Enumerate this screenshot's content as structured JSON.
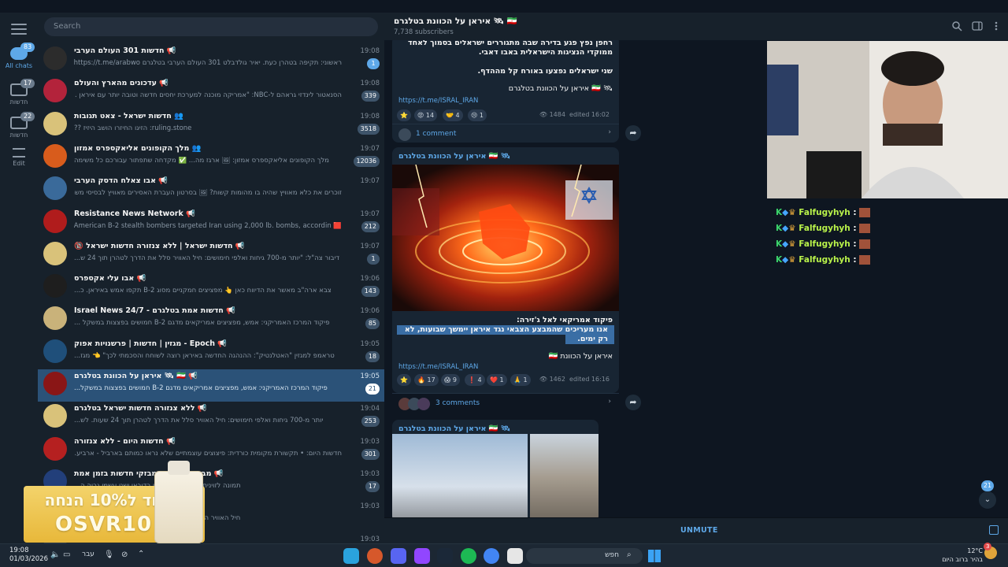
{
  "window": {
    "controls": [
      "–",
      "▢",
      "✕"
    ]
  },
  "rail": {
    "folders": [
      {
        "label": "All chats",
        "badge": "83"
      },
      {
        "label": "חדשות",
        "badge": "17"
      },
      {
        "label": "חדשות",
        "badge": "22"
      },
      {
        "label": "Edit",
        "badge": ""
      }
    ]
  },
  "search": {
    "placeholder": "Search"
  },
  "chats": [
    {
      "name": "📢 חדשות 301 העולם הערבי",
      "time": "19:08",
      "preview": "ראשוני: תקיפה בטהרן כעת. יאיר גולדבלט 301 העולם הערבי בטלגרם https://t.me/arabwo...",
      "count": "1",
      "blue": true
    },
    {
      "name": "📢 עדכונים מהארץ והעולם",
      "time": "19:08",
      "preview": "הסנאטור לינדזי גראהם ל-NBC: \"אמריקה מוכנה למערכת יחסים חדשה וטובה יותר עם איראן ...",
      "count": "339",
      "blue": false
    },
    {
      "name": "👥 חדשות ישראל - צאט תגובות",
      "time": "19:08",
      "preview": "ruling.stone: הזיגו החיזרו הושב היזיז ??",
      "count": "3518",
      "blue": false
    },
    {
      "name": "👥 מלך הקופונים אליאקספרס אמזון",
      "time": "19:07",
      "preview": "מלך הקופונים אליאקספרס אמזון: 🖼 ארגז מה... ✅ מקדחה שתפתור עבורכם כל משימה",
      "count": "12036",
      "blue": false
    },
    {
      "name": "📢 אבו צאלח הדסק הערבי",
      "time": "19:07",
      "preview": "זוכרים את כלא מאוויץ שהיה בו מהומות קשות? 🖼 בסרטון העברת האסירים מאוויץ לבסיסי משמרו...",
      "count": "",
      "blue": false
    },
    {
      "name": "📢 Resistance News Network",
      "time": "19:07",
      "preview": "🟥 Last night, American B-2 stealth bombers targeted Iran using 2,000 lb. bombs, accordin...",
      "count": "212",
      "blue": false
    },
    {
      "name": "📢 חדשות ישראל | ללא צנזורה חדשות ישראל 🔞",
      "time": "19:07",
      "preview": "דיבור צה\"ל: \"יותר מ-700 גיחות ואלפי חימושים: חיל האוויר סלל את הדרך לטהרן תוך 24 ש...",
      "count": "1",
      "blue": false
    },
    {
      "name": "📢 אבו עלי אקספרס",
      "time": "19:06",
      "preview": "צבא ארה\"ב מאשר את הדיווח כאן 👆 מפציצים חמקניים מסוג B-2 תקפו אמש באיראן. כ...",
      "count": "143",
      "blue": false
    },
    {
      "name": "📢 חדשות אמת בטלגרם - Israel News 24/7",
      "time": "19:06",
      "preview": "פיקוד המרכז האמריקני: אמש, מפציצים אמריקאים מדגם B-2 חמושים בפצצות במשקל ...",
      "count": "85",
      "blue": false
    },
    {
      "name": "📢 Epoch - מגזין | חדשות | פרשנויות אפוק",
      "time": "19:05",
      "preview": "טראמפ למגזין \"האטלנטיק\": ההנהגה החדשה באיראן רוצה לשוחח והסכמתי לכך\" 👈 מגז...",
      "count": "18",
      "blue": false
    },
    {
      "name": "📢 🇮🇷 🛰 איראן על הכוונת בטלגרם",
      "time": "19:05",
      "preview": "פיקוד המרכז האמריקני: אמש, מפציצים אמריקאים מדגם B-2 חמושים בפצצות במשקל...",
      "count": "21",
      "blue": false
    },
    {
      "name": "📢 ללא צנזורה חדשות ישראל בטלגרם",
      "time": "19:04",
      "preview": "יותר מ-700 גיחות ואלפי חימושים: חיל האוויר סלל את הדרך לטהרן תוך 24 שעות. לש...",
      "count": "253",
      "blue": false
    },
    {
      "name": "📢 חדשות היום - ללא צנזורה",
      "time": "19:03",
      "preview": "חדשות היום: • תקשורת מקומית כורדית: פיצוצים עוצמתיים שלא נראו כמותם בארביל - ארביע...",
      "count": "301",
      "blue": false
    },
    {
      "name": "📢 מבזקי חדשות - מבזקי חדשות בזמן אמת",
      "time": "19:03",
      "preview": "תמונה לזוינית של נמל ג'בל עלי בדובאי ישני עשמי גבוה ה...",
      "count": "17",
      "blue": false
    },
    {
      "name": "",
      "time": "19:03",
      "preview": "חיל האוויר השיג עליונות אווירית בבירת איראן תוך 24 שעות",
      "count": "",
      "blue": false
    },
    {
      "name": "",
      "time": "19:03",
      "preview": "",
      "count": "",
      "blue": false
    }
  ],
  "header": {
    "title": "🇮🇷 🛰 איראן על הכוונת בטלגרם",
    "subscribers": "7,738 subscribers"
  },
  "messages": [
    {
      "text1": "רחפן נפץ פגע בדירה שבה מתגוררים ישראלים בסמוך לאחד",
      "text2": "ממוקדי הנציגות הישראלית באבו דאבי.",
      "text3": "שני ישראלים נפצעו באורח קל מההדף.",
      "sig": "🛰 🇮🇷 איראן על הכוונת בטלגרם",
      "link": "https://t.me/ISRAL_IRAN",
      "reactions": [
        "⭐",
        "😡 14",
        "🤝 4",
        "😢 1"
      ],
      "views": "👁 1484",
      "edited": "edited 16:02",
      "comments": "1 comment"
    },
    {
      "sender": "🛰 🇮🇷 איראן על הכוונת בטלגרם",
      "text1": "פיקוד אמריקאי לאל ג'זירה:",
      "text2": "אנו מעריכים שהמבצע הצבאי נגד איראן יימשך שבועות, לא",
      "text3": "רק ימים.",
      "sig": "איראן על הכוונת 🇮🇷",
      "link": "https://t.me/ISRAL_IRAN",
      "reactions": [
        "⭐",
        "🔥 17",
        "😱 9",
        "❗ 4",
        "❤️ 1",
        "🙏 1"
      ],
      "views": "👁 1462",
      "edited": "edited 16:16",
      "comments": "3 comments"
    },
    {
      "sender": "🛰 🇮🇷 איראן על הכוונת בטלגרם"
    }
  ],
  "overlay": {
    "lines": [
      {
        "user": "Falfugyhyh",
        "sep": ":"
      },
      {
        "user": "Falfugyhyh",
        "sep": ":"
      },
      {
        "user": "Falfugyhyh",
        "sep": ":"
      },
      {
        "user": "Falfugyhyh",
        "sep": ":"
      }
    ]
  },
  "promo": {
    "line1": "קוד ל10% הנחה",
    "line2": "OSVR10"
  },
  "scroll_badge": "21",
  "input": {
    "unmute": "UNMUTE"
  },
  "taskbar": {
    "time": "19:08",
    "date": "01/03/2026",
    "lang": "עבר",
    "search_placeholder": "חפש",
    "temp": "12°C",
    "weather": "בהיר ברוב היום",
    "notif_badge": "3"
  },
  "colors": {
    "bg": "#0e1621",
    "panel": "#17212b",
    "accent": "#5ea8e8",
    "selected": "#2b5278"
  }
}
